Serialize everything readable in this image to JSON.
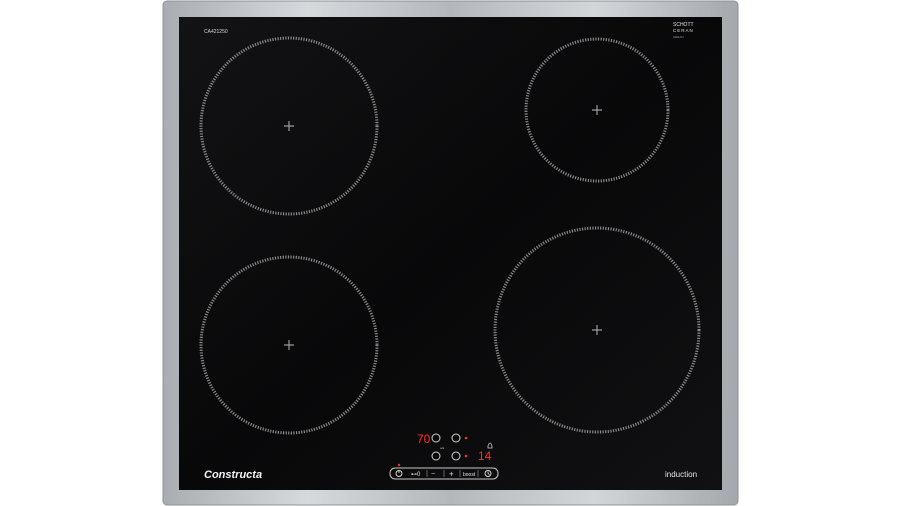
{
  "cooktop": {
    "model_code": "CA421250",
    "brand_logo_text": "Constructa",
    "surface_label": "induction",
    "glass_brand_line1": "SCHOTT",
    "glass_brand_line2": "CERAN",
    "glass_brand_line3": "CERAN"
  },
  "control_panel": {
    "timer_display": "70",
    "power_display": "14",
    "boost_label": "boost",
    "lock_label": "⊷0",
    "minus_label": "−",
    "plus_label": "+",
    "auto_mark": "o/a"
  },
  "colors": {
    "glass": "#0b0b0c",
    "frame": "#b9bcc0",
    "zone_ring": "#8c8c8c",
    "display_red": "#ff2a2a",
    "print_white": "#e8e8e8"
  }
}
